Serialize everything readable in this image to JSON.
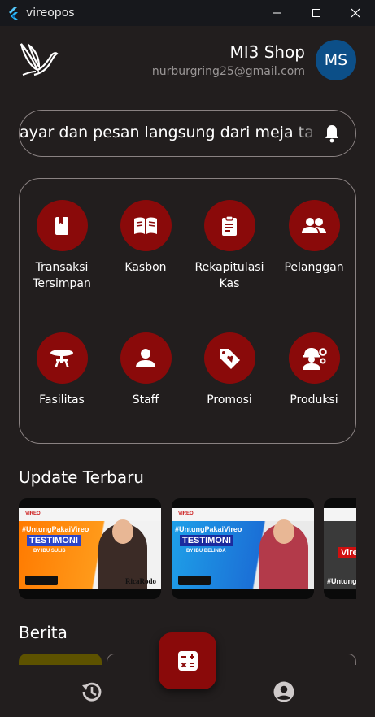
{
  "window": {
    "title": "vireopos"
  },
  "header": {
    "shop_name": "MI3 Shop",
    "email": "nurburgring25@gmail.com",
    "avatar_initials": "MS"
  },
  "announcement": {
    "text": "ayar dan pesan langsung dari meja ta"
  },
  "menu": [
    {
      "label": "Transaksi Tersimpan",
      "icon": "bookmark-book-icon"
    },
    {
      "label": "Kasbon",
      "icon": "open-book-icon"
    },
    {
      "label": "Rekapitulasi Kas",
      "icon": "clipboard-icon"
    },
    {
      "label": "Pelanggan",
      "icon": "people-icon"
    },
    {
      "label": "Fasilitas",
      "icon": "table-icon"
    },
    {
      "label": "Staff",
      "icon": "person-icon"
    },
    {
      "label": "Promosi",
      "icon": "tag-heart-icon"
    },
    {
      "label": "Produksi",
      "icon": "engineer-icon"
    }
  ],
  "updates": {
    "title": "Update Terbaru",
    "cards": [
      {
        "hashtag": "#UntungPakaiVireo",
        "heading": "TESTIMONI",
        "byline": "BY IBU SULIS",
        "brand": "RicaRodo"
      },
      {
        "hashtag": "#UntungPakaiVireo",
        "heading": "TESTIMONI",
        "byline": "BY IBU BELINDA",
        "brand": ""
      },
      {
        "hashtag": "#Untung",
        "heading": "Vire",
        "byline": "",
        "brand": ""
      }
    ]
  },
  "news": {
    "title": "Berita"
  },
  "colors": {
    "background": "#221e1e",
    "accent": "#8a0a0a",
    "avatar": "#0c4f88"
  }
}
